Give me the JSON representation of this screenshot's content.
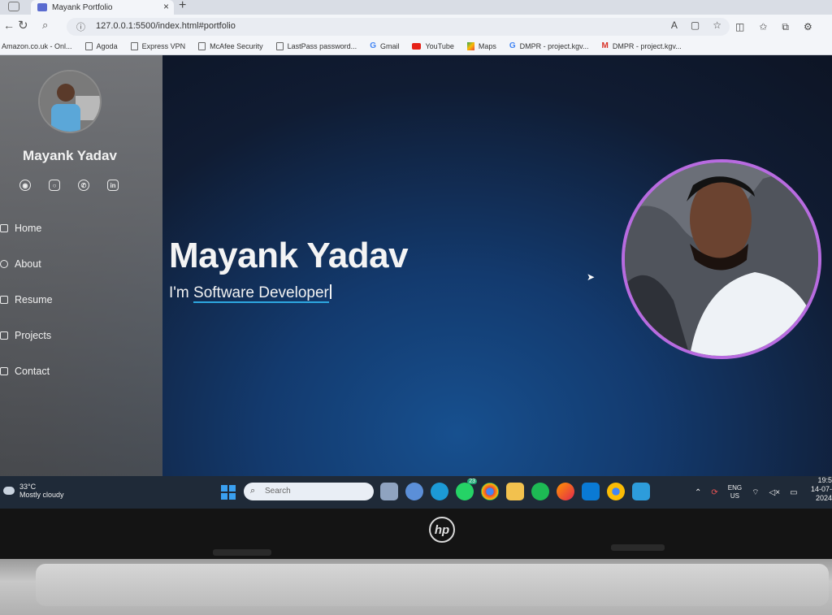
{
  "browser": {
    "tab_title": "Mayank Portfolio",
    "url": "127.0.0.1:5500/index.html#portfolio"
  },
  "bookmarks": [
    {
      "label": "Amazon.co.uk - Onl...",
      "icon": "amazon-icon"
    },
    {
      "label": "Agoda",
      "icon": "page-icon"
    },
    {
      "label": "Express VPN",
      "icon": "page-icon"
    },
    {
      "label": "McAfee Security",
      "icon": "page-icon"
    },
    {
      "label": "LastPass password...",
      "icon": "page-icon"
    },
    {
      "label": "Gmail",
      "icon": "google-icon"
    },
    {
      "label": "YouTube",
      "icon": "youtube-icon"
    },
    {
      "label": "Maps",
      "icon": "maps-icon"
    },
    {
      "label": "DMPR - project.kgv...",
      "icon": "google-icon"
    },
    {
      "label": "DMPR - project.kgv...",
      "icon": "gmail-icon"
    }
  ],
  "sidebar": {
    "name": "Mayank Yadav",
    "socials": [
      "github-icon",
      "instagram-icon",
      "whatsapp-icon",
      "linkedin-icon"
    ],
    "menu": [
      {
        "label": "Home",
        "icon": "home-icon"
      },
      {
        "label": "About",
        "icon": "person-icon"
      },
      {
        "label": "Resume",
        "icon": "file-icon"
      },
      {
        "label": "Projects",
        "icon": "image-icon"
      },
      {
        "label": "Contact",
        "icon": "envelope-icon"
      }
    ]
  },
  "hero": {
    "title": "Mayank Yadav",
    "prefix": "I'm ",
    "typed": "Software Developer"
  },
  "taskbar": {
    "temp": "33°C",
    "weather": "Mostly cloudy",
    "search_placeholder": "Search",
    "lang_1": "ENG",
    "lang_2": "US",
    "time": "19:5",
    "date": "14-07-2024",
    "whatsapp_badge": "23"
  },
  "colors": {
    "accent_ring": "#b86be0",
    "underline": "#2da7e0",
    "page_bg": "#101c33"
  }
}
